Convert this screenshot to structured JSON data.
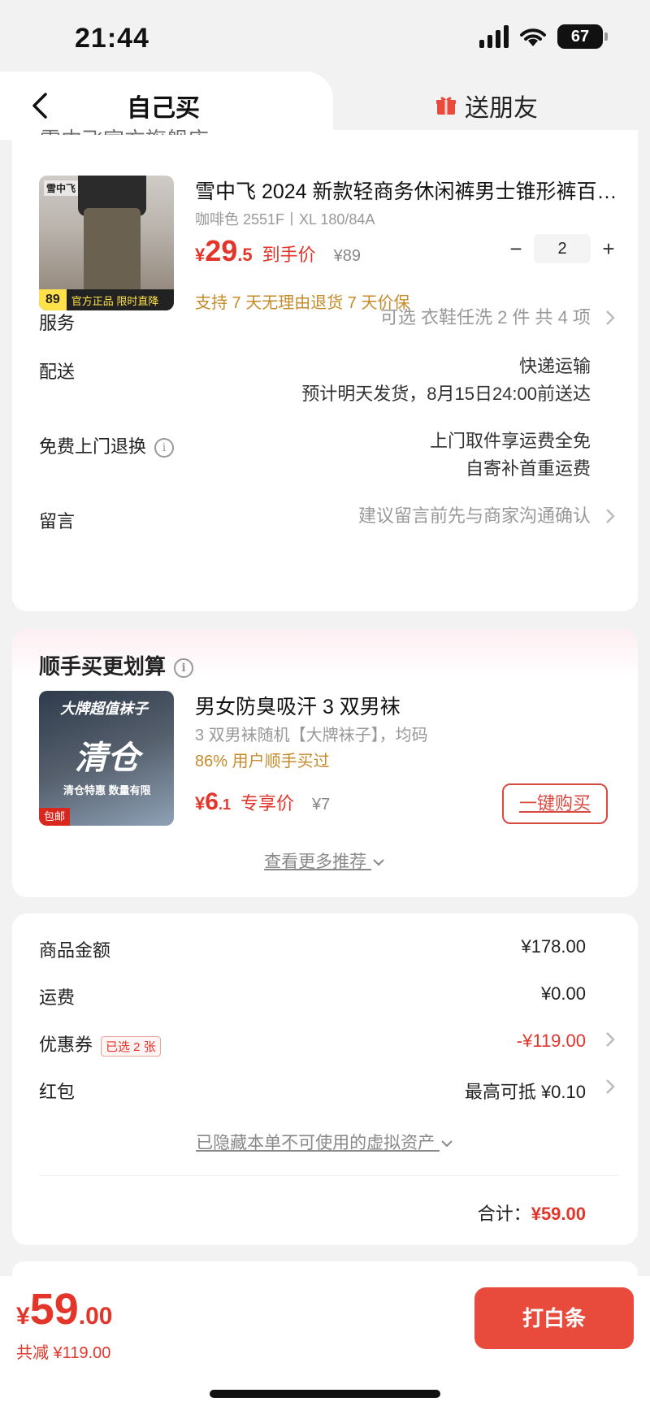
{
  "status_bar": {
    "time": "21:44",
    "battery": "67"
  },
  "tabs": {
    "self_buy": "自己买",
    "send_friend": "送朋友"
  },
  "shop": {
    "name_partial": "雪中飞官方旗舰店"
  },
  "product": {
    "title": "雪中飞 2024 新款轻商务休闲裤男士锥形裤百…",
    "sku": "咖啡色 2551F丨XL 180/84A",
    "price_yen": "¥",
    "price_int": "29",
    "price_dec": ".5",
    "price_label": "到手价",
    "original_price": "¥89",
    "quantity": "2",
    "minus": "−",
    "plus": "+",
    "promise": "支持 7 天无理由退货   7 天价保",
    "thumb_logo": "雪中飞",
    "thumb_price": "89",
    "thumb_text": "官方正品 限时直降"
  },
  "rows": {
    "service": {
      "label": "服务",
      "value": "可选 衣鞋任洗 2 件 共 4 项"
    },
    "delivery": {
      "label": "配送",
      "value1": "快递运输",
      "value2": "预计明天发货，8月15日24:00前送达"
    },
    "return": {
      "label": "免费上门退换",
      "value1": "上门取件享运费全免",
      "value2": "自寄补首重运费"
    },
    "message": {
      "label": "留言",
      "value": "建议留言前先与商家沟通确认"
    }
  },
  "addon": {
    "section_title": "顺手买更划算",
    "title": "男女防臭吸汗 3 双男袜",
    "sub": "3 双男袜随机【大牌袜子】，均码",
    "pct": "86% 用户顺手买过",
    "price_yen": "¥",
    "price_int": "6",
    "price_dec": ".1",
    "price_label": "专享价",
    "original_price": "¥7",
    "buy_button": "一键购买",
    "more": "查看更多推荐",
    "thumb_line1": "大牌超值袜子",
    "thumb_line2": "清仓",
    "thumb_line3": "清仓特惠 数量有限",
    "thumb_tag": "包邮"
  },
  "summary": {
    "goods_label": "商品金额",
    "goods_value": "¥178.00",
    "shipping_label": "运费",
    "shipping_value": "¥0.00",
    "coupon_label": "优惠券",
    "coupon_badge": "已选 2 张",
    "coupon_value": "-¥119.00",
    "redpack_label": "红包",
    "redpack_value": "最高可抵 ¥0.10",
    "hidden_assets": "已隐藏本单不可使用的虚拟资产",
    "total_label": "合计：",
    "total_value": "¥59.00"
  },
  "bottom": {
    "price_yen": "¥",
    "price_int": "59",
    "price_dec": ".00",
    "saved": "共减 ¥119.00",
    "pay_button": "打白条"
  },
  "colors": {
    "accent_red": "#e3352a",
    "gold": "#c58b2a"
  }
}
